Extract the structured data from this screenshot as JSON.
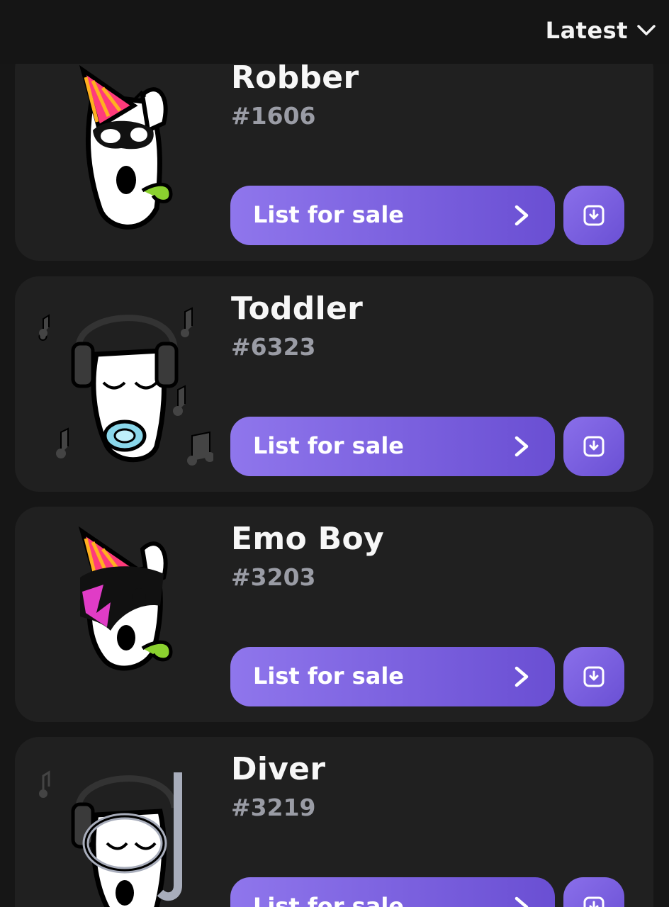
{
  "header": {
    "sort_label": "Latest"
  },
  "items": [
    {
      "name": "Robber",
      "number": "#1606",
      "list_label": "List for sale"
    },
    {
      "name": "Toddler",
      "number": "#6323",
      "list_label": "List for sale"
    },
    {
      "name": "Emo Boy",
      "number": "#3203",
      "list_label": "List for sale"
    },
    {
      "name": "Diver",
      "number": "#3219",
      "list_label": "List for sale"
    }
  ],
  "colors": {
    "accent_start": "#8f76ec",
    "accent_end": "#6a4fd3",
    "card": "#202020",
    "background": "#161616"
  },
  "icons": {
    "sort": "chevron-down-icon",
    "list": "chevron-right-icon",
    "download": "download-icon"
  }
}
